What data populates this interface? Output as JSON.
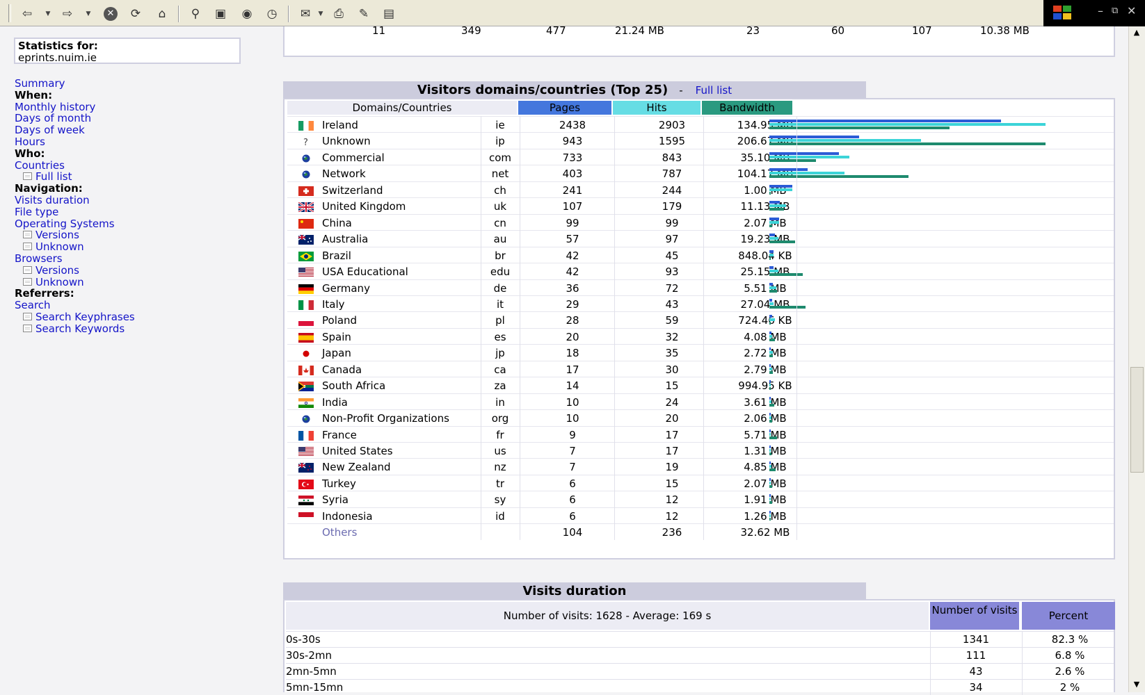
{
  "toolbar": {
    "icons": [
      "back-icon",
      "forward-icon",
      "stop-icon",
      "refresh-icon",
      "home-icon",
      "search-icon",
      "favorites-icon",
      "media-icon",
      "history-icon",
      "mail-icon",
      "print-icon",
      "edit-icon",
      "discuss-icon"
    ]
  },
  "sidebar": {
    "stats_label": "Statistics for:",
    "stats_site": "eprints.nuim.ie",
    "menu": [
      {
        "text": "Summary",
        "kind": "link"
      },
      {
        "text": "When:",
        "kind": "header"
      },
      {
        "text": "Monthly history",
        "kind": "link"
      },
      {
        "text": "Days of month",
        "kind": "link"
      },
      {
        "text": "Days of week",
        "kind": "link"
      },
      {
        "text": "Hours",
        "kind": "link"
      },
      {
        "text": "Who:",
        "kind": "header"
      },
      {
        "text": "Countries",
        "kind": "link"
      },
      {
        "text": "Full list",
        "kind": "sub"
      },
      {
        "text": "Navigation:",
        "kind": "header"
      },
      {
        "text": "Visits duration",
        "kind": "link"
      },
      {
        "text": "File type",
        "kind": "link"
      },
      {
        "text": "Operating Systems",
        "kind": "link"
      },
      {
        "text": "Versions",
        "kind": "sub"
      },
      {
        "text": "Unknown",
        "kind": "sub"
      },
      {
        "text": "Browsers",
        "kind": "link"
      },
      {
        "text": "Versions",
        "kind": "sub"
      },
      {
        "text": "Unknown",
        "kind": "sub"
      },
      {
        "text": "Referrers:",
        "kind": "header"
      },
      {
        "text": "Search",
        "kind": "link"
      },
      {
        "text": "Search Keyphrases",
        "kind": "sub"
      },
      {
        "text": "Search Keywords",
        "kind": "sub"
      }
    ]
  },
  "top_partial_row": [
    "11",
    "349",
    "477",
    "21.24 MB",
    "23",
    "60",
    "107",
    "10.38 MB"
  ],
  "countries": {
    "title": "Visitors domains/countries (Top 25)",
    "dash": "-",
    "full_list": "Full list",
    "headers": {
      "domain": "Domains/Countries",
      "pages": "Pages",
      "hits": "Hits",
      "bandwidth": "Bandwidth"
    },
    "colors": {
      "pages": "#4477dd",
      "hits": "#66dde4",
      "bandwidth": "#2a9a80"
    },
    "rows": [
      {
        "name": "Ireland",
        "code": "ie",
        "pages": "2438",
        "hits": "2903",
        "bandwidth": "134.95 MB",
        "flag": "flag-ireland",
        "bw_mb": 134.95
      },
      {
        "name": "Unknown",
        "code": "ip",
        "pages": "943",
        "hits": "1595",
        "bandwidth": "206.67 MB",
        "flag": "unknown-icon",
        "bw_mb": 206.67
      },
      {
        "name": "Commercial",
        "code": "com",
        "pages": "733",
        "hits": "843",
        "bandwidth": "35.10 MB",
        "flag": "globe-icon",
        "bw_mb": 35.1
      },
      {
        "name": "Network",
        "code": "net",
        "pages": "403",
        "hits": "787",
        "bandwidth": "104.17 MB",
        "flag": "globe-icon",
        "bw_mb": 104.17
      },
      {
        "name": "Switzerland",
        "code": "ch",
        "pages": "241",
        "hits": "244",
        "bandwidth": "1.00 MB",
        "flag": "flag-switzerland",
        "bw_mb": 1.0
      },
      {
        "name": "United Kingdom",
        "code": "uk",
        "pages": "107",
        "hits": "179",
        "bandwidth": "11.13 MB",
        "flag": "flag-uk",
        "bw_mb": 11.13
      },
      {
        "name": "China",
        "code": "cn",
        "pages": "99",
        "hits": "99",
        "bandwidth": "2.07 MB",
        "flag": "flag-china",
        "bw_mb": 2.07
      },
      {
        "name": "Australia",
        "code": "au",
        "pages": "57",
        "hits": "97",
        "bandwidth": "19.23 MB",
        "flag": "flag-australia",
        "bw_mb": 19.23
      },
      {
        "name": "Brazil",
        "code": "br",
        "pages": "42",
        "hits": "45",
        "bandwidth": "848.04 KB",
        "flag": "flag-brazil",
        "bw_mb": 0.83
      },
      {
        "name": "USA Educational",
        "code": "edu",
        "pages": "42",
        "hits": "93",
        "bandwidth": "25.15 MB",
        "flag": "flag-usa",
        "bw_mb": 25.15
      },
      {
        "name": "Germany",
        "code": "de",
        "pages": "36",
        "hits": "72",
        "bandwidth": "5.51 MB",
        "flag": "flag-germany",
        "bw_mb": 5.51
      },
      {
        "name": "Italy",
        "code": "it",
        "pages": "29",
        "hits": "43",
        "bandwidth": "27.04 MB",
        "flag": "flag-italy",
        "bw_mb": 27.04
      },
      {
        "name": "Poland",
        "code": "pl",
        "pages": "28",
        "hits": "59",
        "bandwidth": "724.46 KB",
        "flag": "flag-poland",
        "bw_mb": 0.71
      },
      {
        "name": "Spain",
        "code": "es",
        "pages": "20",
        "hits": "32",
        "bandwidth": "4.08 MB",
        "flag": "flag-spain",
        "bw_mb": 4.08
      },
      {
        "name": "Japan",
        "code": "jp",
        "pages": "18",
        "hits": "35",
        "bandwidth": "2.72 MB",
        "flag": "flag-japan",
        "bw_mb": 2.72
      },
      {
        "name": "Canada",
        "code": "ca",
        "pages": "17",
        "hits": "30",
        "bandwidth": "2.79 MB",
        "flag": "flag-canada",
        "bw_mb": 2.79
      },
      {
        "name": "South Africa",
        "code": "za",
        "pages": "14",
        "hits": "15",
        "bandwidth": "994.95 KB",
        "flag": "flag-south-africa",
        "bw_mb": 0.97
      },
      {
        "name": "India",
        "code": "in",
        "pages": "10",
        "hits": "24",
        "bandwidth": "3.61 MB",
        "flag": "flag-india",
        "bw_mb": 3.61
      },
      {
        "name": "Non-Profit Organizations",
        "code": "org",
        "pages": "10",
        "hits": "20",
        "bandwidth": "2.06 MB",
        "flag": "globe-icon",
        "bw_mb": 2.06
      },
      {
        "name": "France",
        "code": "fr",
        "pages": "9",
        "hits": "17",
        "bandwidth": "5.71 MB",
        "flag": "flag-france",
        "bw_mb": 5.71
      },
      {
        "name": "United States",
        "code": "us",
        "pages": "7",
        "hits": "17",
        "bandwidth": "1.31 MB",
        "flag": "flag-usa",
        "bw_mb": 1.31
      },
      {
        "name": "New Zealand",
        "code": "nz",
        "pages": "7",
        "hits": "19",
        "bandwidth": "4.85 MB",
        "flag": "flag-new-zealand",
        "bw_mb": 4.85
      },
      {
        "name": "Turkey",
        "code": "tr",
        "pages": "6",
        "hits": "15",
        "bandwidth": "2.07 MB",
        "flag": "flag-turkey",
        "bw_mb": 2.07
      },
      {
        "name": "Syria",
        "code": "sy",
        "pages": "6",
        "hits": "12",
        "bandwidth": "1.91 MB",
        "flag": "flag-syria",
        "bw_mb": 1.91
      },
      {
        "name": "Indonesia",
        "code": "id",
        "pages": "6",
        "hits": "12",
        "bandwidth": "1.26 MB",
        "flag": "flag-indonesia",
        "bw_mb": 1.26
      }
    ],
    "others": {
      "name": "Others",
      "pages": "104",
      "hits": "236",
      "bandwidth": "32.62 MB"
    }
  },
  "visits_duration": {
    "title": "Visits duration",
    "summary": "Number of visits: 1628 - Average: 169 s",
    "col_number": "Number of visits",
    "col_percent": "Percent",
    "rows": [
      {
        "range": "0s-30s",
        "number": "1341",
        "percent": "82.3 %"
      },
      {
        "range": "30s-2mn",
        "number": "111",
        "percent": "6.8 %"
      },
      {
        "range": "2mn-5mn",
        "number": "43",
        "percent": "2.6 %"
      },
      {
        "range": "5mn-15mn",
        "number": "34",
        "percent": "2 %"
      }
    ]
  }
}
